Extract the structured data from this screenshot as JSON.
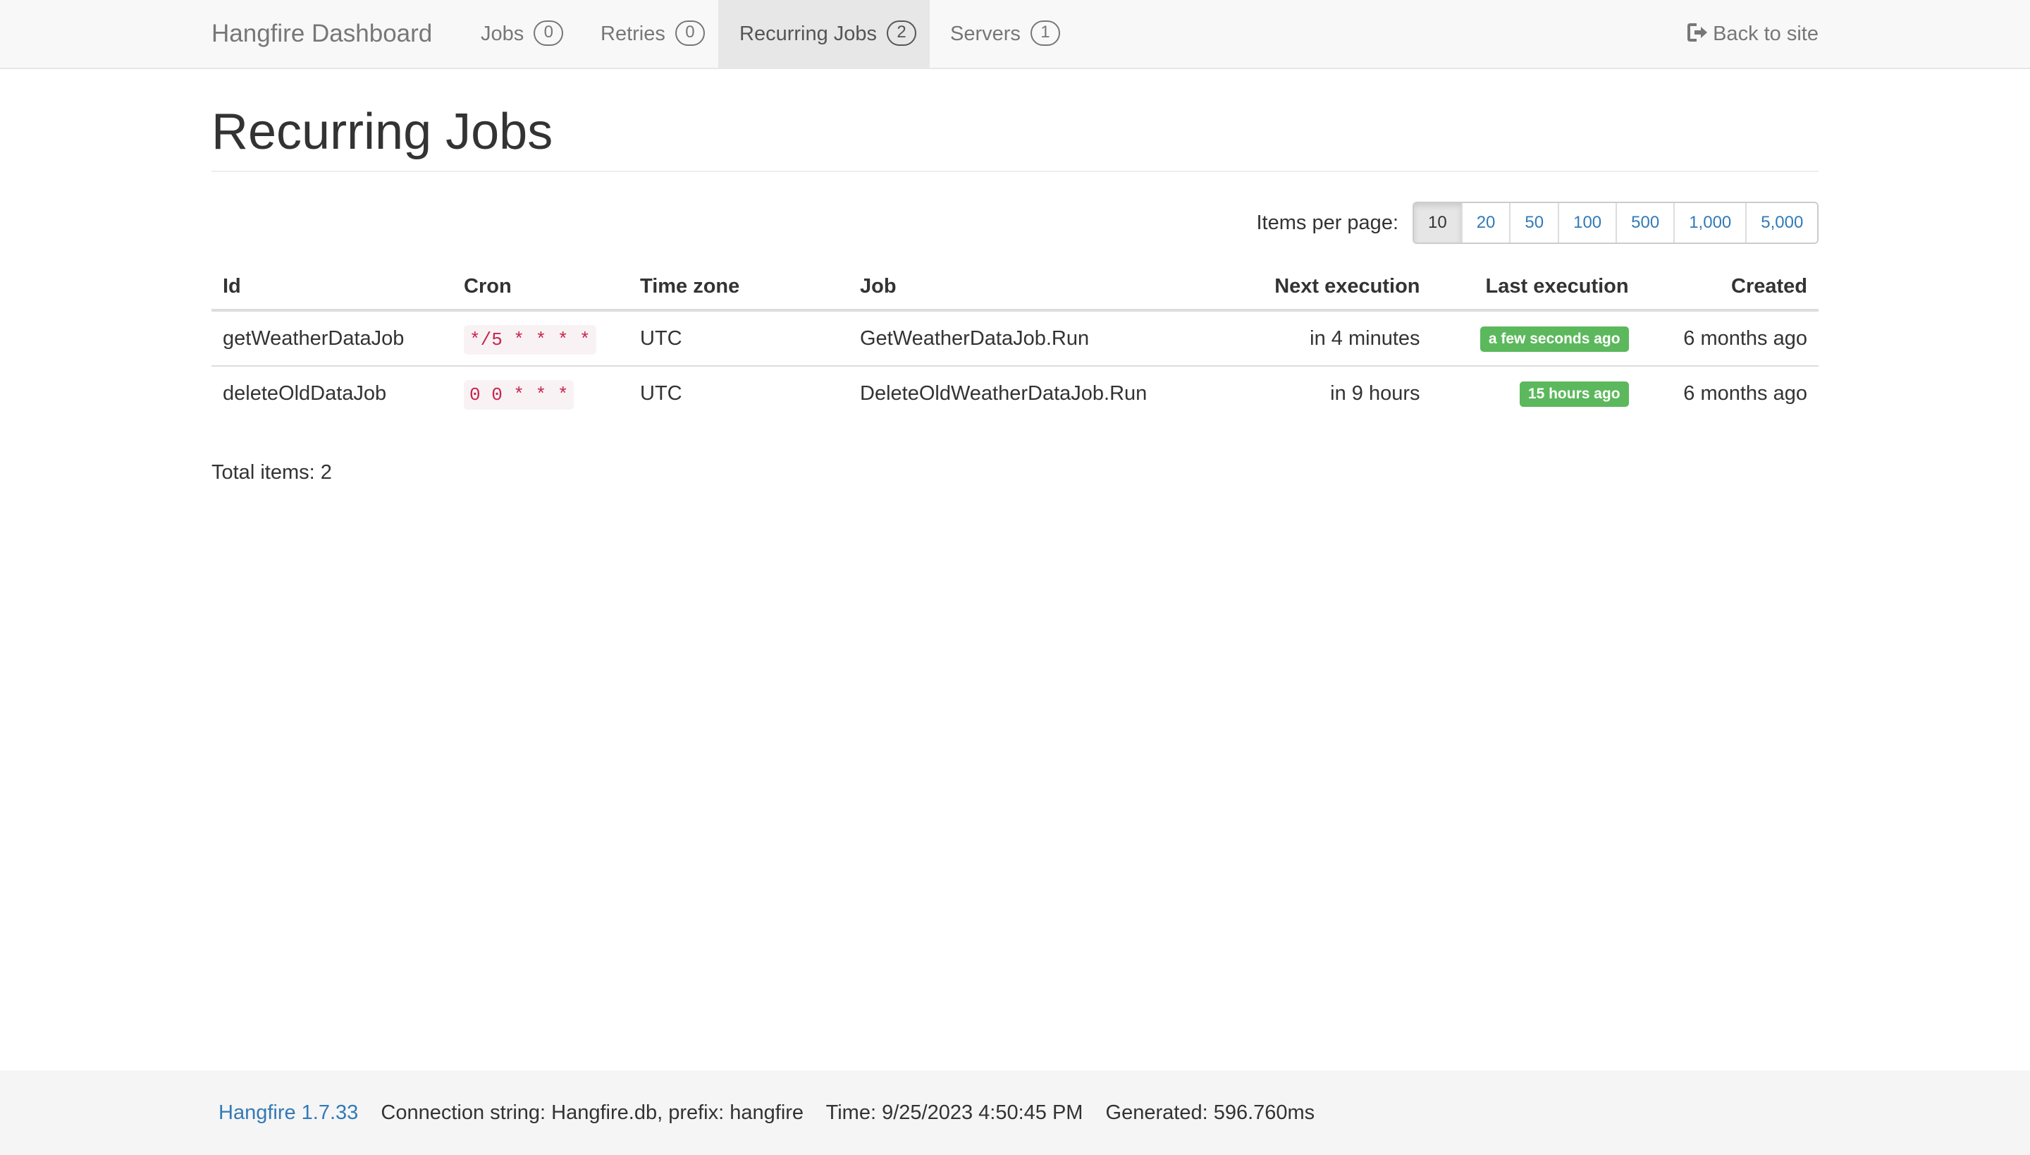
{
  "nav": {
    "brand": "Hangfire Dashboard",
    "items": [
      {
        "label": "Jobs",
        "count": "0"
      },
      {
        "label": "Retries",
        "count": "0"
      },
      {
        "label": "Recurring Jobs",
        "count": "2"
      },
      {
        "label": "Servers",
        "count": "1"
      }
    ],
    "active_item": "Recurring Jobs",
    "back_label": "Back to site",
    "back_icon": "sign-out-icon"
  },
  "page": {
    "title": "Recurring Jobs"
  },
  "pager": {
    "label": "Items per page:",
    "options": [
      "10",
      "20",
      "50",
      "100",
      "500",
      "1,000",
      "5,000"
    ],
    "selected": "10"
  },
  "table": {
    "headers": [
      "Id",
      "Cron",
      "Time zone",
      "Job",
      "Next execution",
      "Last execution",
      "Created"
    ],
    "rows": [
      {
        "id": "getWeatherDataJob",
        "cron": "*/5 * * * *",
        "timezone": "UTC",
        "job": "GetWeatherDataJob.Run",
        "next": "in 4 minutes",
        "last": "a few seconds ago",
        "created": "6 months ago"
      },
      {
        "id": "deleteOldDataJob",
        "cron": "0 0 * * *",
        "timezone": "UTC",
        "job": "DeleteOldWeatherDataJob.Run",
        "next": "in 9 hours",
        "last": "15 hours ago",
        "created": "6 months ago"
      }
    ]
  },
  "total": "Total items: 2",
  "footer": {
    "version": "Hangfire 1.7.33",
    "connection": "Connection string: Hangfire.db, prefix: hangfire",
    "time": "Time: 9/25/2023 4:50:45 PM",
    "generated": "Generated: 596.760ms"
  },
  "colors": {
    "success_label": "#5cb85c",
    "link": "#337ab7",
    "cron_text": "#c7254e",
    "cron_bg": "#f9f2f4",
    "navbar_bg": "#f8f8f8"
  }
}
